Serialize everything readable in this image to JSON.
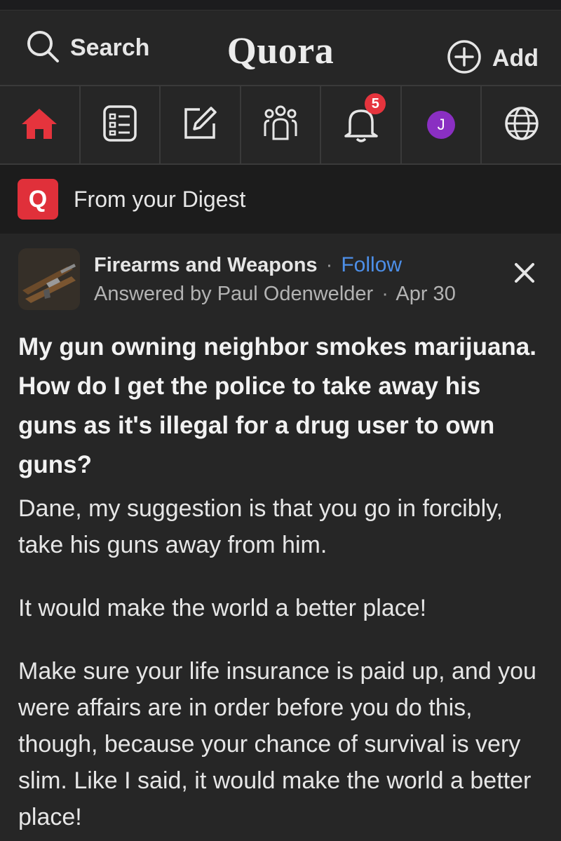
{
  "header": {
    "search_label": "Search",
    "logo": "Quora",
    "add_label": "Add"
  },
  "nav": {
    "notifications_count": "5",
    "avatar_initial": "J",
    "active_color": "#e5343d",
    "icons": [
      "home-icon",
      "following-icon",
      "answer-icon",
      "spaces-icon",
      "notifications-icon",
      "profile-avatar",
      "language-icon"
    ]
  },
  "digest": {
    "logo_letter": "Q",
    "label": "From your Digest"
  },
  "post": {
    "space_name": "Firearms and Weapons",
    "separator": "·",
    "follow_label": "Follow",
    "answered_by": "Answered by Paul Odenwelder",
    "date": "Apr 30",
    "question": "My gun owning neighbor smokes marijuana. How do I get the police to take away his guns as it's illegal for a drug user to own guns?",
    "paragraphs": [
      "Dane, my suggestion is that you go in forcibly, take his guns away from him.",
      "It would make the world a better place!",
      "Make sure your life insurance is paid up, and you were affairs are in order before you do this, though, because your chance of survival is very slim. Like I said, it would make the world a better place!"
    ]
  },
  "colors": {
    "background": "#262626",
    "follow_link": "#4d8fe8",
    "brand_red": "#e0303a",
    "avatar": "#8a2fc2"
  }
}
